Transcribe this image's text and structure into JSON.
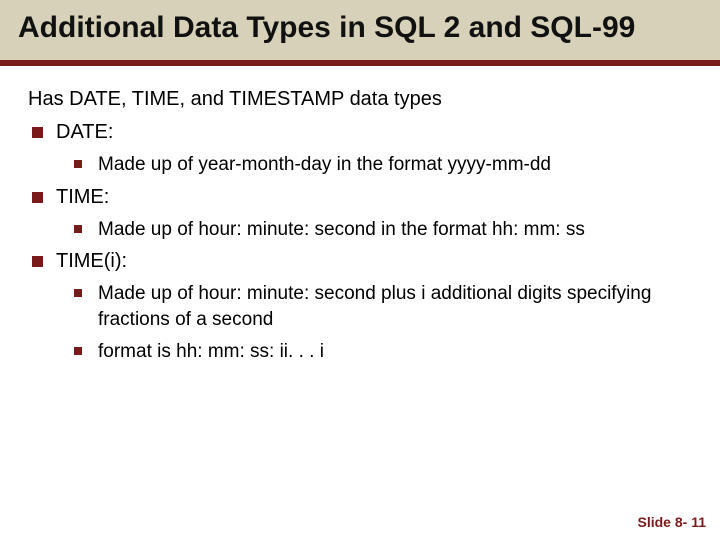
{
  "title": "Additional Data Types in SQL 2 and SQL-99",
  "intro": "Has DATE, TIME, and TIMESTAMP data types",
  "items": [
    {
      "label": "DATE:",
      "sub": [
        "Made up of year-month-day in the format yyyy-mm-dd"
      ]
    },
    {
      "label": "TIME:",
      "sub": [
        "Made up of hour: minute: second in the format hh: mm: ss"
      ]
    },
    {
      "label": "TIME(i):",
      "sub": [
        "Made up of hour: minute: second plus i additional digits specifying fractions of a second",
        "format is hh: mm: ss: ii. . . i"
      ]
    }
  ],
  "footer": "Slide 8- 11"
}
